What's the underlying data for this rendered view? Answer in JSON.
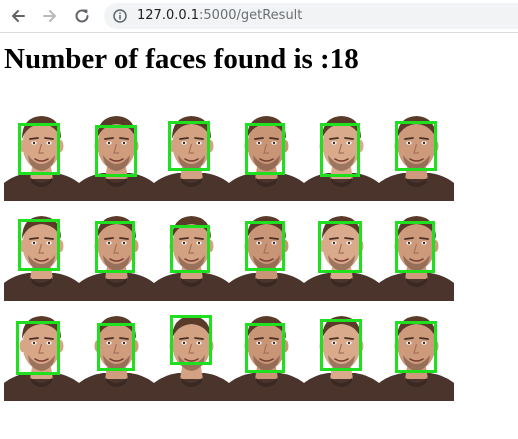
{
  "browser": {
    "back_icon": "arrow-left-icon",
    "forward_icon": "arrow-right-icon",
    "reload_icon": "reload-icon",
    "info_icon": "info-icon",
    "url_host": "127.0.0.1",
    "url_rest": ":5000/getResult"
  },
  "page": {
    "heading": "Number of faces found is :18"
  },
  "result_image": {
    "rows": 3,
    "columns": 6,
    "face_count": 18,
    "box_color": "#1fe01f",
    "watermark_present": true
  }
}
